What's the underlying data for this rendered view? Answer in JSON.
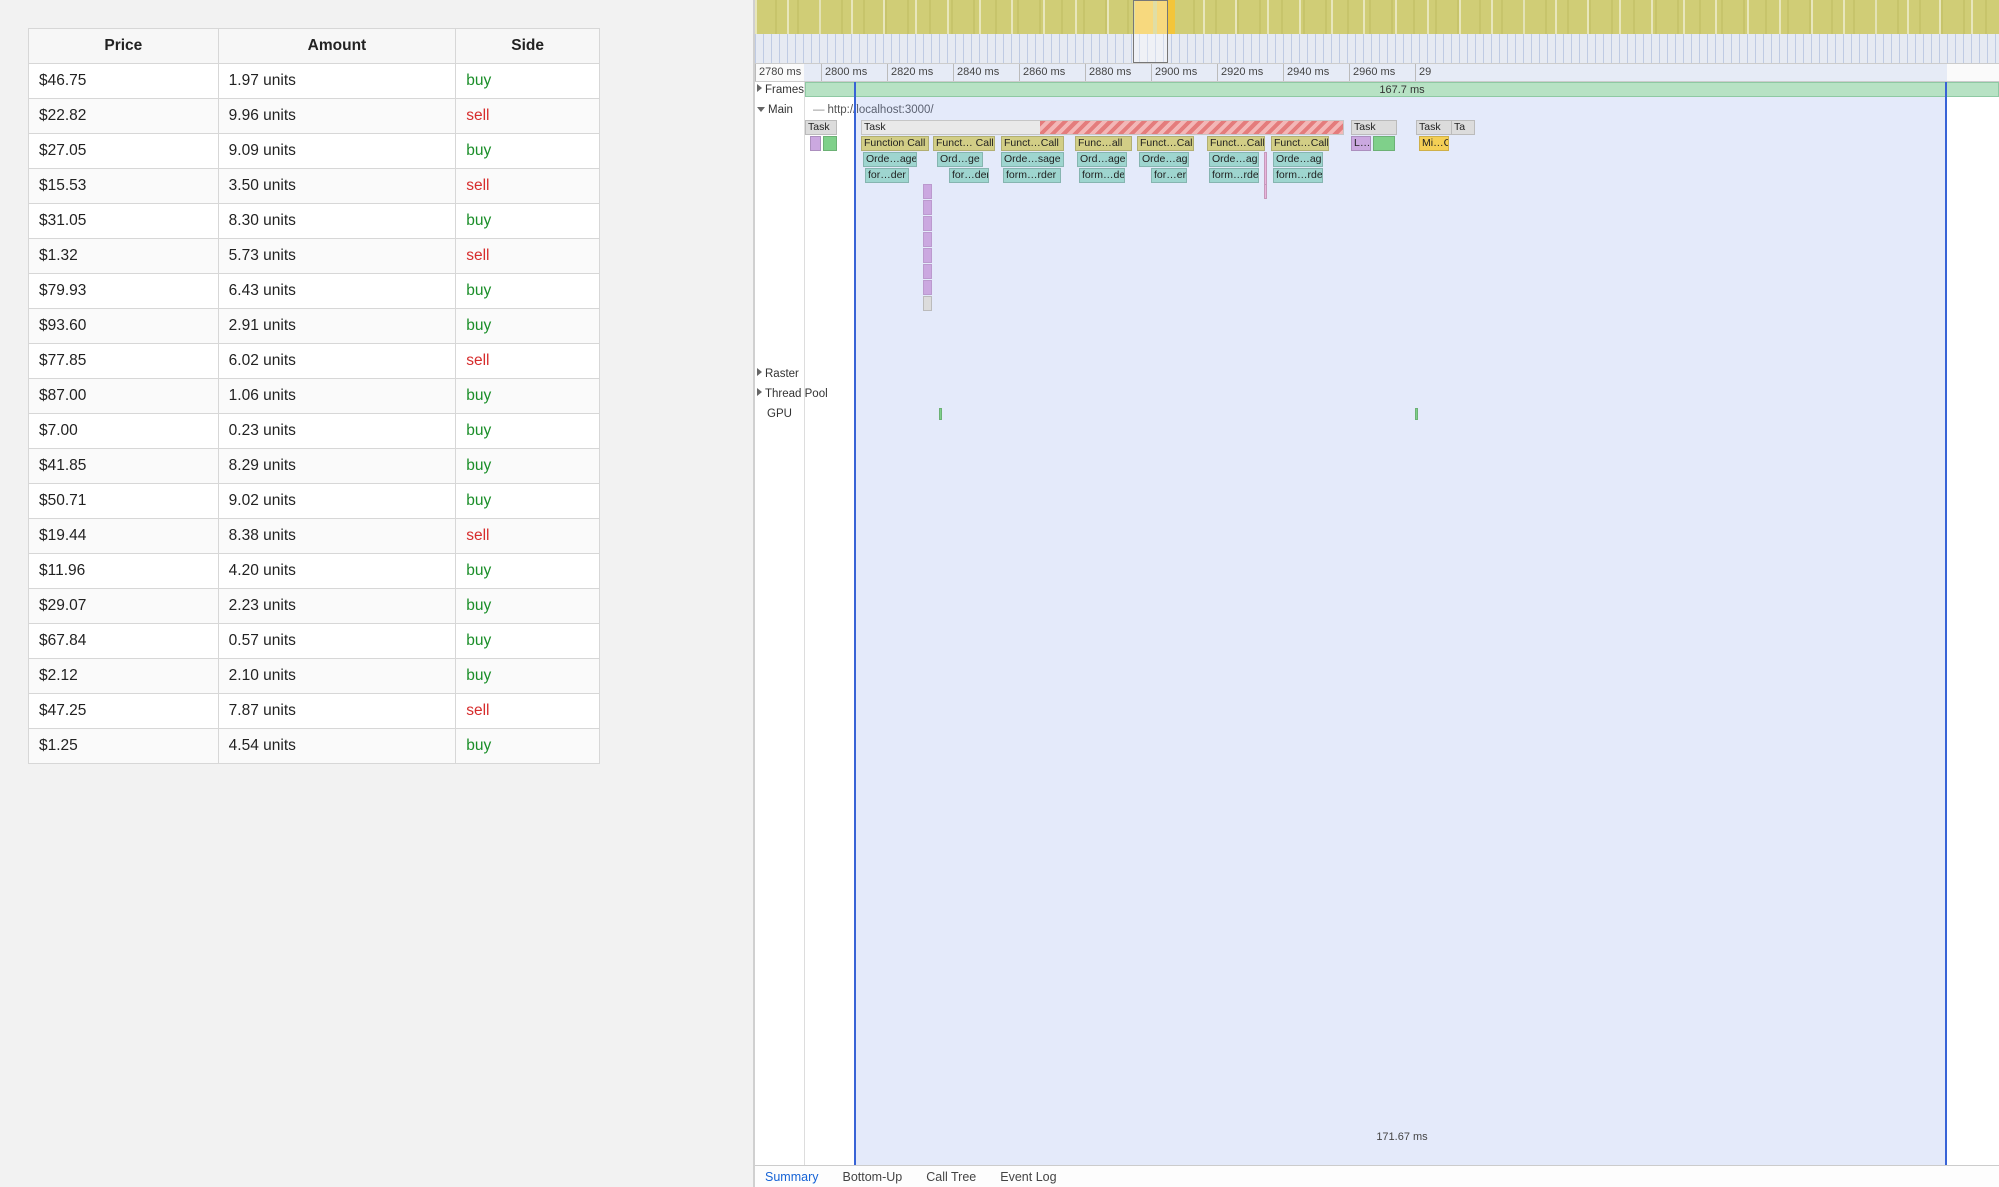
{
  "orders": {
    "headers": {
      "price": "Price",
      "amount": "Amount",
      "side": "Side"
    },
    "rows": [
      {
        "price": "$46.75",
        "amount": "1.97 units",
        "side": "buy"
      },
      {
        "price": "$22.82",
        "amount": "9.96 units",
        "side": "sell"
      },
      {
        "price": "$27.05",
        "amount": "9.09 units",
        "side": "buy"
      },
      {
        "price": "$15.53",
        "amount": "3.50 units",
        "side": "sell"
      },
      {
        "price": "$31.05",
        "amount": "8.30 units",
        "side": "buy"
      },
      {
        "price": "$1.32",
        "amount": "5.73 units",
        "side": "sell"
      },
      {
        "price": "$79.93",
        "amount": "6.43 units",
        "side": "buy"
      },
      {
        "price": "$93.60",
        "amount": "2.91 units",
        "side": "buy"
      },
      {
        "price": "$77.85",
        "amount": "6.02 units",
        "side": "sell"
      },
      {
        "price": "$87.00",
        "amount": "1.06 units",
        "side": "buy"
      },
      {
        "price": "$7.00",
        "amount": "0.23 units",
        "side": "buy"
      },
      {
        "price": "$41.85",
        "amount": "8.29 units",
        "side": "buy"
      },
      {
        "price": "$50.71",
        "amount": "9.02 units",
        "side": "buy"
      },
      {
        "price": "$19.44",
        "amount": "8.38 units",
        "side": "sell"
      },
      {
        "price": "$11.96",
        "amount": "4.20 units",
        "side": "buy"
      },
      {
        "price": "$29.07",
        "amount": "2.23 units",
        "side": "buy"
      },
      {
        "price": "$67.84",
        "amount": "0.57 units",
        "side": "buy"
      },
      {
        "price": "$2.12",
        "amount": "2.10 units",
        "side": "buy"
      },
      {
        "price": "$47.25",
        "amount": "7.87 units",
        "side": "sell"
      },
      {
        "price": "$1.25",
        "amount": "4.54 units",
        "side": "buy"
      }
    ]
  },
  "devtools": {
    "ruler_ticks": [
      "2780 ms",
      "2800 ms",
      "2820 ms",
      "2840 ms",
      "2860 ms",
      "2880 ms",
      "2900 ms",
      "2920 ms",
      "2940 ms",
      "2960 ms",
      "29"
    ],
    "selection_label": "167.7 ms",
    "bottom_duration": "171.67 ms",
    "tracks": {
      "frames": "Frames",
      "main": "Main",
      "main_url": "http://localhost:3000/",
      "raster": "Raster",
      "thread_pool": "Thread Pool",
      "gpu": "GPU"
    },
    "flame": {
      "task": "Task",
      "function_call": "Function Call",
      "funct_call_trunc": "Funct… Call",
      "funct_call_trunc2": "Funct…Call",
      "func_all_trunc": "Func…all",
      "orde_age": "Orde…age",
      "ord_ge": "Ord…ge",
      "ord_age": "Ord…age",
      "orde_sage": "Orde…sage",
      "for_der": "for…der",
      "form_rder": "form…rder",
      "form_der": "form…der",
      "for_er": "for…er",
      "L": "L…",
      "MiC": "Mi…C",
      "Ta": "Ta"
    },
    "tabs": {
      "summary": "Summary",
      "bottom_up": "Bottom-Up",
      "call_tree": "Call Tree",
      "event_log": "Event Log"
    }
  }
}
